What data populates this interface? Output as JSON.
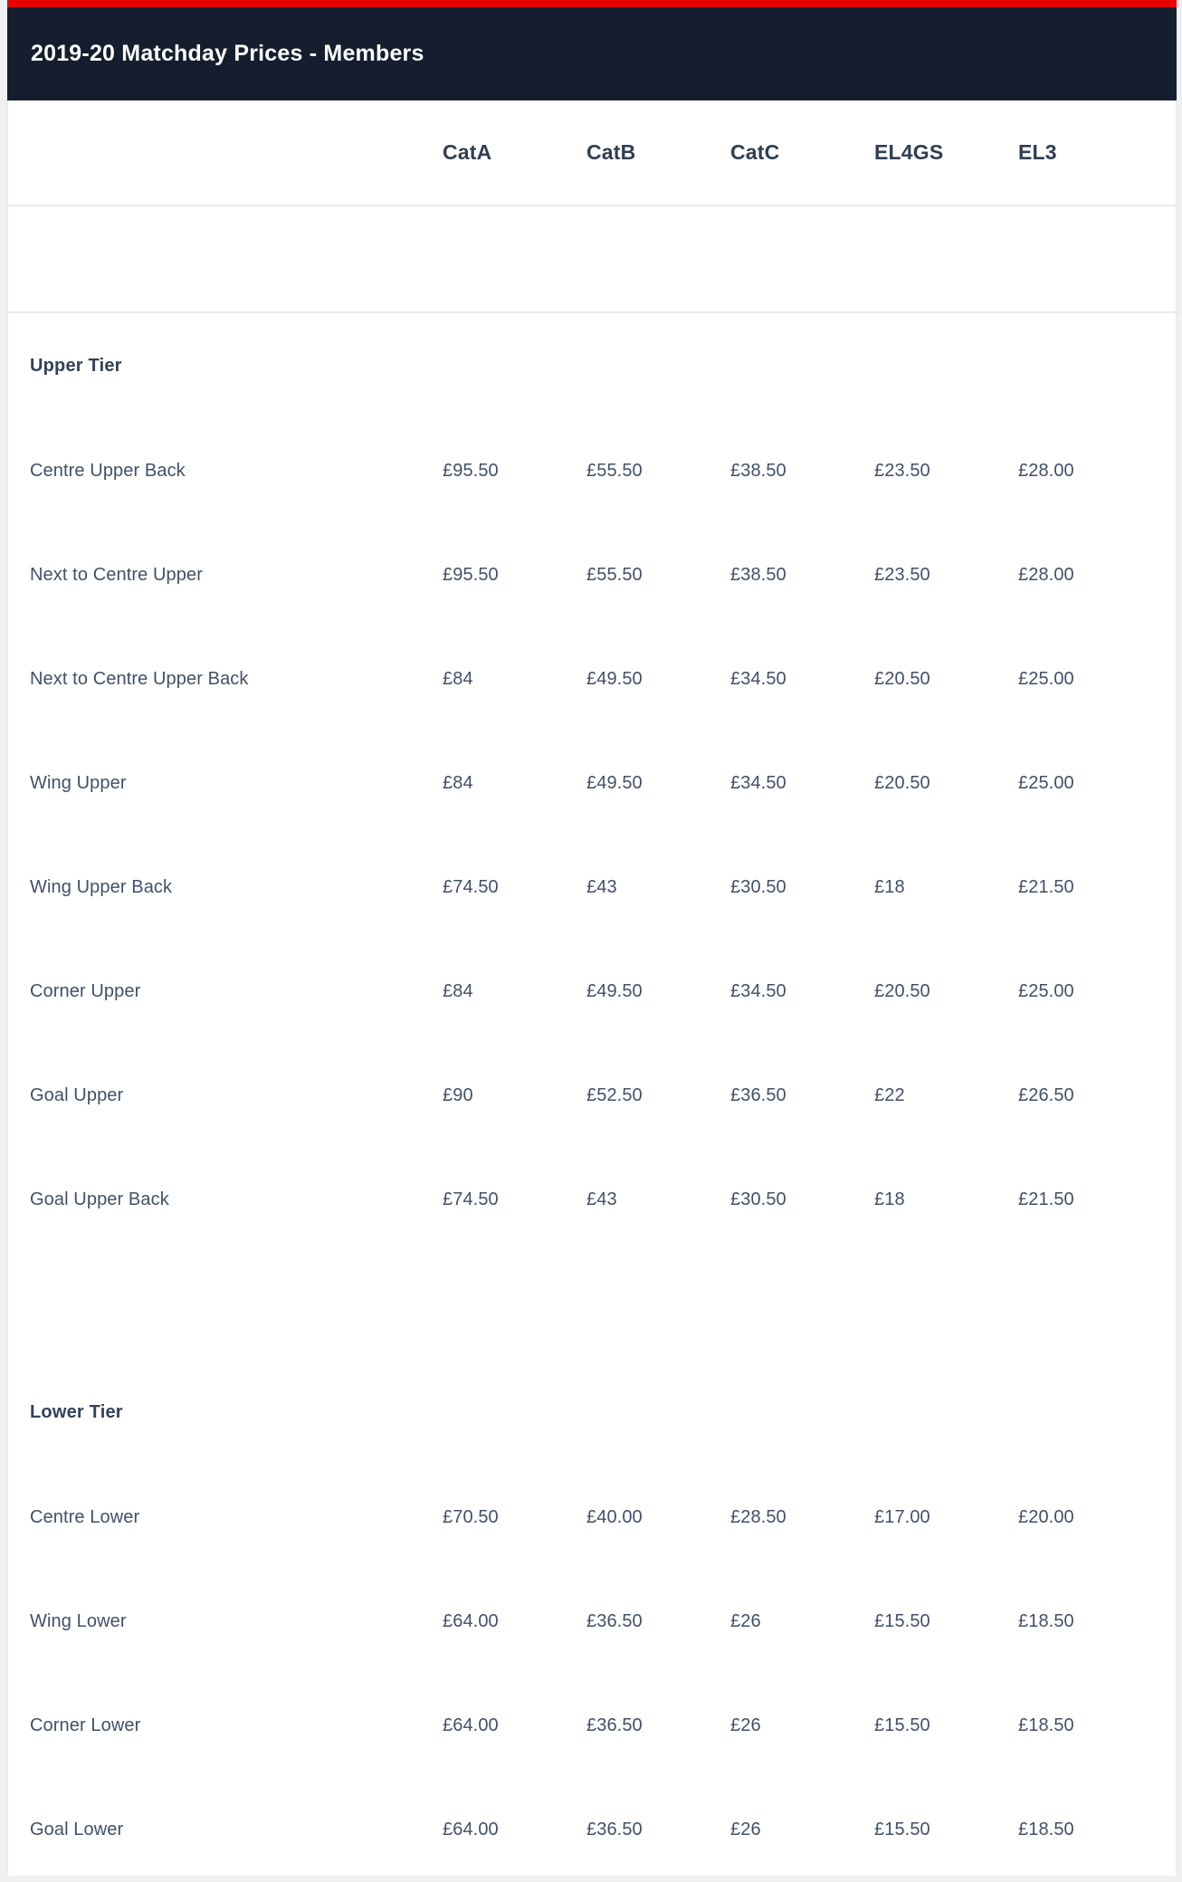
{
  "colors": {
    "accent": "#e70000",
    "header_bg": "#141e2e",
    "page_bg": "#eff0f2",
    "table_bg": "#ffffff",
    "divider": "#e9eaec",
    "heading_text": "#2f3e52",
    "body_text": "#41506a",
    "title_text": "#ffffff"
  },
  "header": {
    "title": "2019-20 Matchday Prices - Members"
  },
  "table": {
    "label_column_header": "",
    "columns": [
      "CatA",
      "CatB",
      "CatC",
      "EL4GS",
      "EL3"
    ],
    "sections": [
      {
        "name": "Upper Tier",
        "rows": [
          {
            "label": "Centre Upper Back",
            "values": [
              "£95.50",
              "£55.50",
              "£38.50",
              "£23.50",
              "£28.00"
            ]
          },
          {
            "label": "Next to Centre Upper",
            "values": [
              "£95.50",
              "£55.50",
              "£38.50",
              "£23.50",
              "£28.00"
            ]
          },
          {
            "label": "Next to Centre Upper Back",
            "values": [
              "£84",
              "£49.50",
              "£34.50",
              "£20.50",
              "£25.00"
            ]
          },
          {
            "label": "Wing Upper",
            "values": [
              "£84",
              "£49.50",
              "£34.50",
              "£20.50",
              "£25.00"
            ]
          },
          {
            "label": "Wing Upper Back",
            "values": [
              "£74.50",
              "£43",
              "£30.50",
              "£18",
              "£21.50"
            ]
          },
          {
            "label": "Corner Upper",
            "values": [
              "£84",
              "£49.50",
              "£34.50",
              "£20.50",
              "£25.00"
            ]
          },
          {
            "label": "Goal Upper",
            "values": [
              "£90",
              "£52.50",
              "£36.50",
              "£22",
              "£26.50"
            ]
          },
          {
            "label": "Goal Upper Back",
            "values": [
              "£74.50",
              "£43",
              "£30.50",
              "£18",
              "£21.50"
            ]
          }
        ]
      },
      {
        "name": "Lower Tier",
        "rows": [
          {
            "label": "Centre Lower",
            "values": [
              "£70.50",
              "£40.00",
              "£28.50",
              "£17.00",
              "£20.00"
            ]
          },
          {
            "label": "Wing Lower",
            "values": [
              "£64.00",
              "£36.50",
              "£26",
              "£15.50",
              "£18.50"
            ]
          },
          {
            "label": "Corner Lower",
            "values": [
              "£64.00",
              "£36.50",
              "£26",
              "£15.50",
              "£18.50"
            ]
          },
          {
            "label": "Goal Lower",
            "values": [
              "£64.00",
              "£36.50",
              "£26",
              "£15.50",
              "£18.50"
            ]
          }
        ]
      }
    ]
  }
}
